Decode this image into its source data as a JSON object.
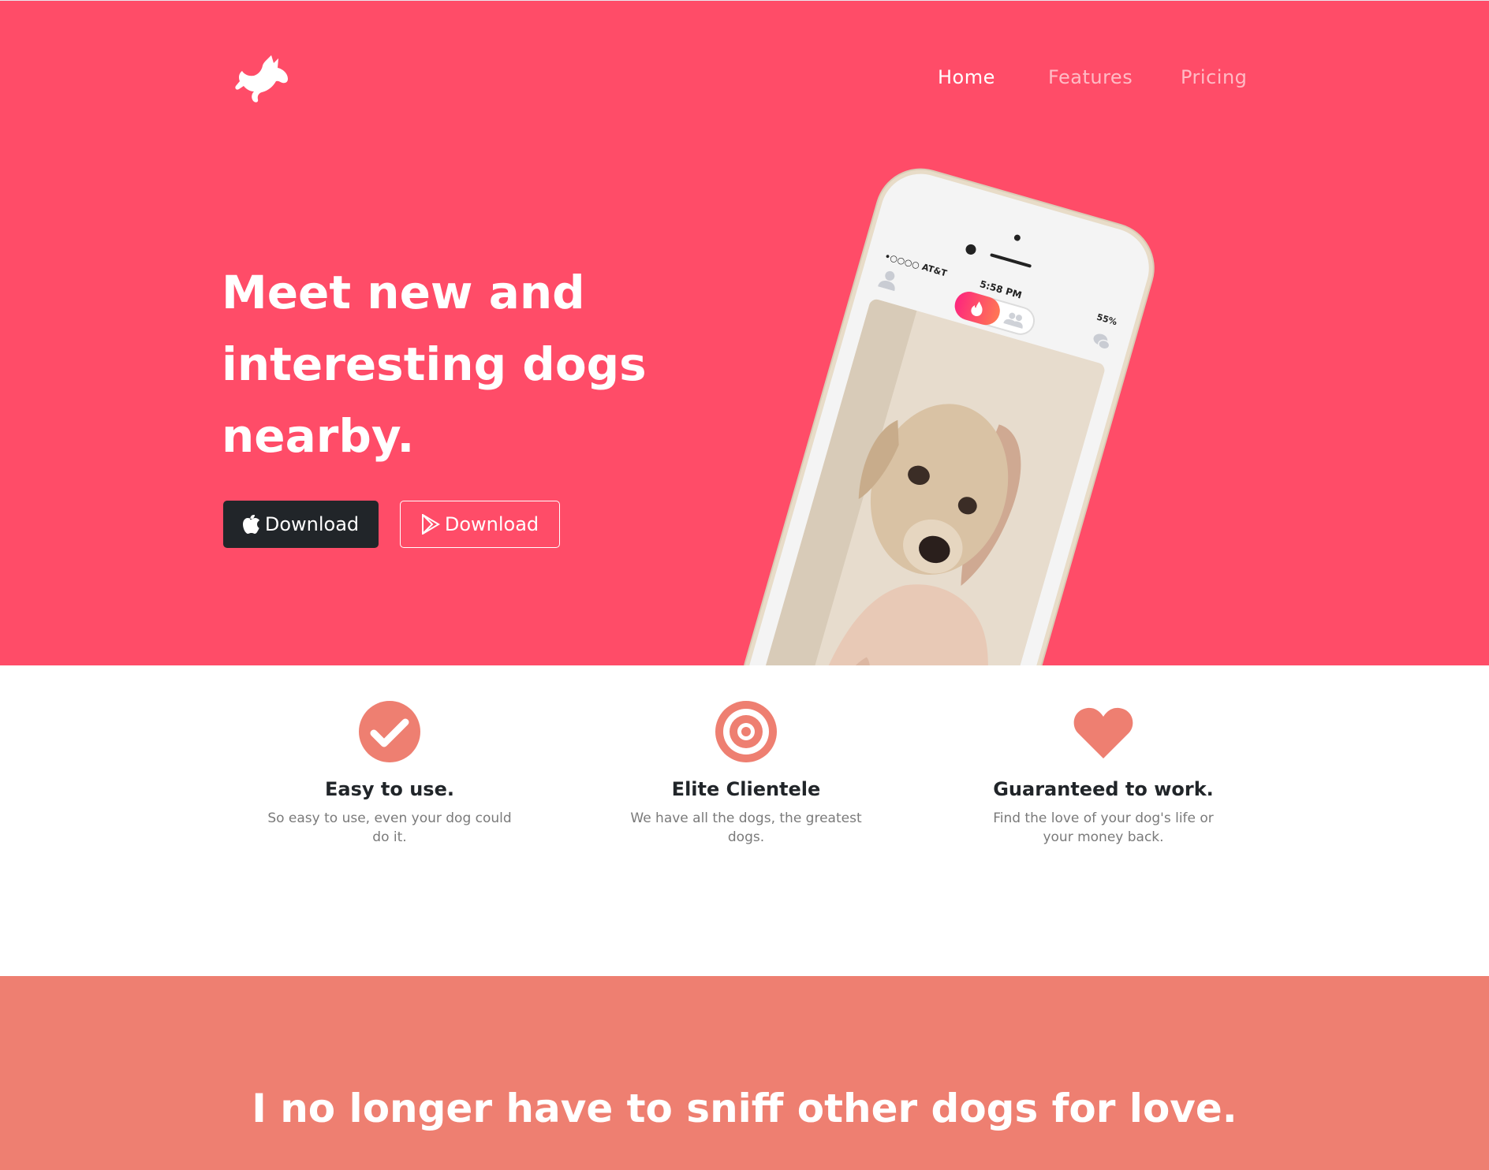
{
  "header": {
    "logo_icon": "running-dog-icon",
    "nav": {
      "home": "Home",
      "features": "Features",
      "pricing": "Pricing"
    }
  },
  "hero": {
    "headline": "Meet new and interesting dogs nearby.",
    "buttons": {
      "app_store": {
        "label": "Download",
        "icon": "apple-icon"
      },
      "google_play": {
        "label": "Download",
        "icon": "google-play-icon"
      }
    },
    "phone": {
      "carrier": "•○○○○ AT&T",
      "time": "5:58 PM",
      "battery": "55%"
    }
  },
  "features": [
    {
      "icon": "checkmark-circle-icon",
      "title": "Easy to use.",
      "text": "So easy to use, even your dog could do it."
    },
    {
      "icon": "target-icon",
      "title": "Elite Clientele",
      "text": "We have all the dogs, the greatest dogs."
    },
    {
      "icon": "heart-icon",
      "title": "Guaranteed to work.",
      "text": "Find the love of your dog's life or your money back."
    }
  ],
  "testimonial": {
    "quote": "I no longer have to sniff other dogs for love."
  },
  "colors": {
    "hero_bg": "#ff4c68",
    "band_bg": "#ee7f71",
    "icon_color": "#ee7f71",
    "dark_button": "#212529"
  }
}
